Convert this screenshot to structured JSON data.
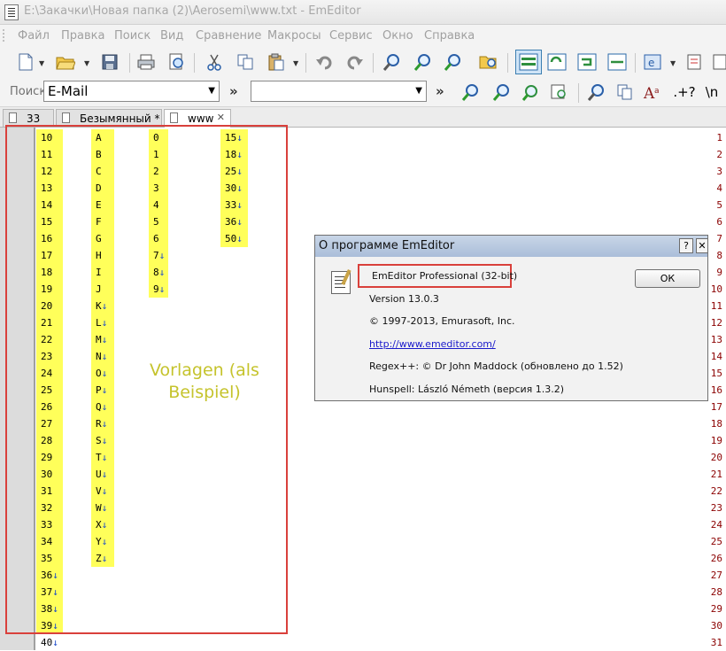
{
  "window": {
    "title": "E:\\Закачки\\Новая папка (2)\\Aerosemi\\www.txt - EmEditor"
  },
  "menu": [
    "Файл",
    "Правка",
    "Поиск",
    "Вид",
    "Сравнение",
    "Макросы",
    "Сервис",
    "Окно",
    "Справка"
  ],
  "toolbar": {
    "icons": [
      "new-file-icon",
      "open-folder-icon",
      "save-icon",
      "print-icon",
      "print-preview-icon",
      "cut-icon",
      "copy-icon",
      "paste-icon",
      "undo-icon",
      "redo-icon",
      "find-icon",
      "find-next-icon",
      "find-prev-icon",
      "find-in-files-icon",
      "word-wrap-icon",
      "wrap-by-window-icon",
      "wrap-by-char-icon",
      "no-wrap-icon",
      "encoding-icon",
      "notes-icon"
    ]
  },
  "search": {
    "label": "Поиск",
    "value": "E-Mail",
    "second_value": "",
    "chevron": "»",
    "regex_symbol": ".+?",
    "escape_symbol": "\\n"
  },
  "tabs": [
    {
      "label": "33",
      "closable": false
    },
    {
      "label": "Безымянный *",
      "closable": false
    },
    {
      "label": "www",
      "closable": true
    }
  ],
  "editor": {
    "line_numbers": [
      "1",
      "2",
      "3",
      "4",
      "5",
      "6",
      "7",
      "8",
      "9",
      "10",
      "11",
      "12",
      "13",
      "14",
      "15",
      "16",
      "17",
      "18",
      "19",
      "20",
      "21",
      "22",
      "23",
      "24",
      "25",
      "26",
      "27",
      "28",
      "29",
      "30",
      "31"
    ],
    "col1": [
      "10",
      "11",
      "12",
      "13",
      "14",
      "15",
      "16",
      "17",
      "18",
      "19",
      "20",
      "21",
      "22",
      "23",
      "24",
      "25",
      "26",
      "27",
      "28",
      "29",
      "30",
      "31",
      "32",
      "33",
      "34",
      "35",
      "36",
      "37",
      "38",
      "39",
      "40"
    ],
    "col2": [
      "A",
      "B",
      "C",
      "D",
      "E",
      "F",
      "G",
      "H",
      "I",
      "J",
      "K",
      "L",
      "M",
      "N",
      "O",
      "P",
      "Q",
      "R",
      "S",
      "T",
      "U",
      "V",
      "W",
      "X",
      "Y",
      "Z"
    ],
    "col3": [
      "0",
      "1",
      "2",
      "3",
      "4",
      "5",
      "6",
      "7",
      "8",
      "9"
    ],
    "col4": [
      "15",
      "18",
      "25",
      "30",
      "33",
      "36",
      "50"
    ],
    "newline_mark": "↓",
    "highlight_color": "#ffff5a"
  },
  "annotation": {
    "text": "Vorlagen (als Beispiel)",
    "color": "#c5c32c",
    "box_color": "#d9403b"
  },
  "about": {
    "title": "О программе EmEditor",
    "help_button": "?",
    "close_button": "✕",
    "product": "EmEditor Professional (32-bit)",
    "version": "Version 13.0.3",
    "copyright": "© 1997-2013, Emurasoft, Inc.",
    "url": "http://www.emeditor.com/",
    "regex": "Regex++: © Dr John Maddock (обновлено до 1.52)",
    "hunspell": "Hunspell: László Németh (версия 1.3.2)",
    "ok_label": "ОК"
  }
}
